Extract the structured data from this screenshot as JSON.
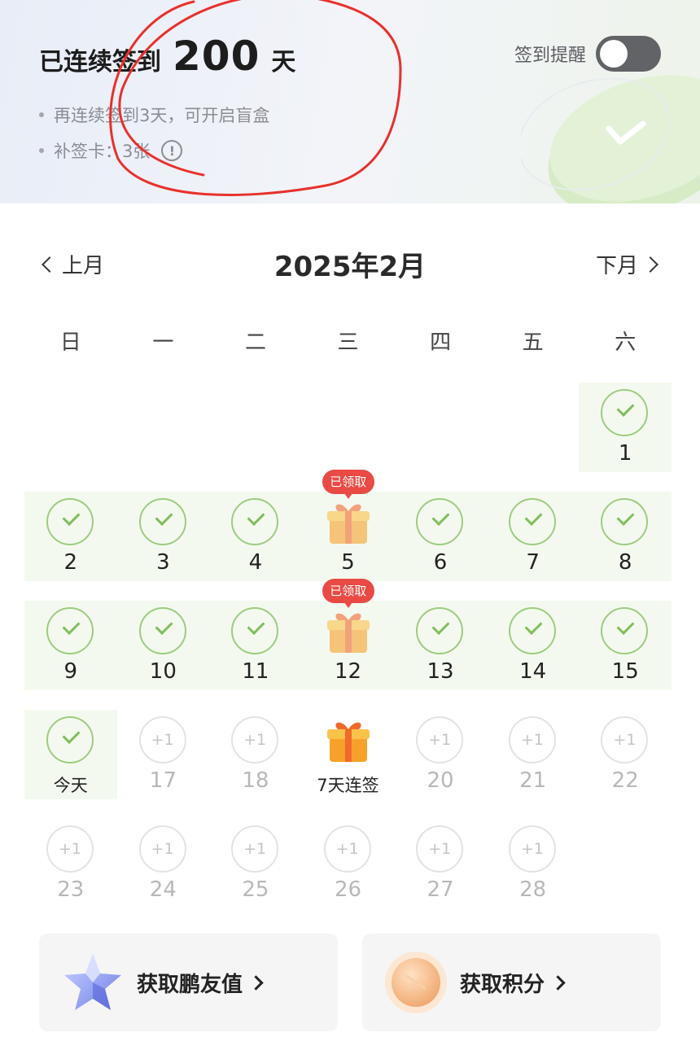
{
  "header": {
    "streak_prefix": "已连续签到",
    "streak_count": "200",
    "streak_unit": "天",
    "bullets": [
      {
        "text": "再连续签到3天，可开启盲盒"
      },
      {
        "text": "补签卡：3张"
      }
    ],
    "reminder_label": "签到提醒",
    "reminder_on": false
  },
  "month_nav": {
    "prev_label": "上月",
    "title": "2025年2月",
    "next_label": "下月"
  },
  "weekdays": [
    "日",
    "一",
    "二",
    "三",
    "四",
    "五",
    "六"
  ],
  "calendar": {
    "claimed_badge": "已领取",
    "rows": [
      [
        null,
        null,
        null,
        null,
        null,
        null,
        {
          "label": "1",
          "state": "checked"
        }
      ],
      [
        {
          "label": "2",
          "state": "checked"
        },
        {
          "label": "3",
          "state": "checked"
        },
        {
          "label": "4",
          "state": "checked"
        },
        {
          "label": "5",
          "state": "gift-claimed"
        },
        {
          "label": "6",
          "state": "checked"
        },
        {
          "label": "7",
          "state": "checked"
        },
        {
          "label": "8",
          "state": "checked"
        }
      ],
      [
        {
          "label": "9",
          "state": "checked"
        },
        {
          "label": "10",
          "state": "checked"
        },
        {
          "label": "11",
          "state": "checked"
        },
        {
          "label": "12",
          "state": "gift-claimed"
        },
        {
          "label": "13",
          "state": "checked"
        },
        {
          "label": "14",
          "state": "checked"
        },
        {
          "label": "15",
          "state": "checked"
        }
      ],
      [
        {
          "label": "今天",
          "state": "today"
        },
        {
          "label": "17",
          "state": "pending",
          "reward": "+1"
        },
        {
          "label": "18",
          "state": "pending",
          "reward": "+1"
        },
        {
          "label": "7天连签",
          "state": "gift"
        },
        {
          "label": "20",
          "state": "pending",
          "reward": "+1"
        },
        {
          "label": "21",
          "state": "pending",
          "reward": "+1"
        },
        {
          "label": "22",
          "state": "pending",
          "reward": "+1"
        }
      ],
      [
        {
          "label": "23",
          "state": "pending",
          "reward": "+1"
        },
        {
          "label": "24",
          "state": "pending",
          "reward": "+1"
        },
        {
          "label": "25",
          "state": "pending",
          "reward": "+1"
        },
        {
          "label": "26",
          "state": "pending",
          "reward": "+1"
        },
        {
          "label": "27",
          "state": "pending",
          "reward": "+1"
        },
        {
          "label": "28",
          "state": "pending",
          "reward": "+1"
        },
        null
      ]
    ]
  },
  "cards": {
    "friend_label": "获取鹏友值",
    "points_label": "获取积分"
  },
  "colors": {
    "check_green": "#7fbf5c",
    "row_bg": "#f4f9ef",
    "badge_red": "#ea4a44",
    "gift_orange": "#f7a12a",
    "annotation_red": "#e8312c"
  }
}
